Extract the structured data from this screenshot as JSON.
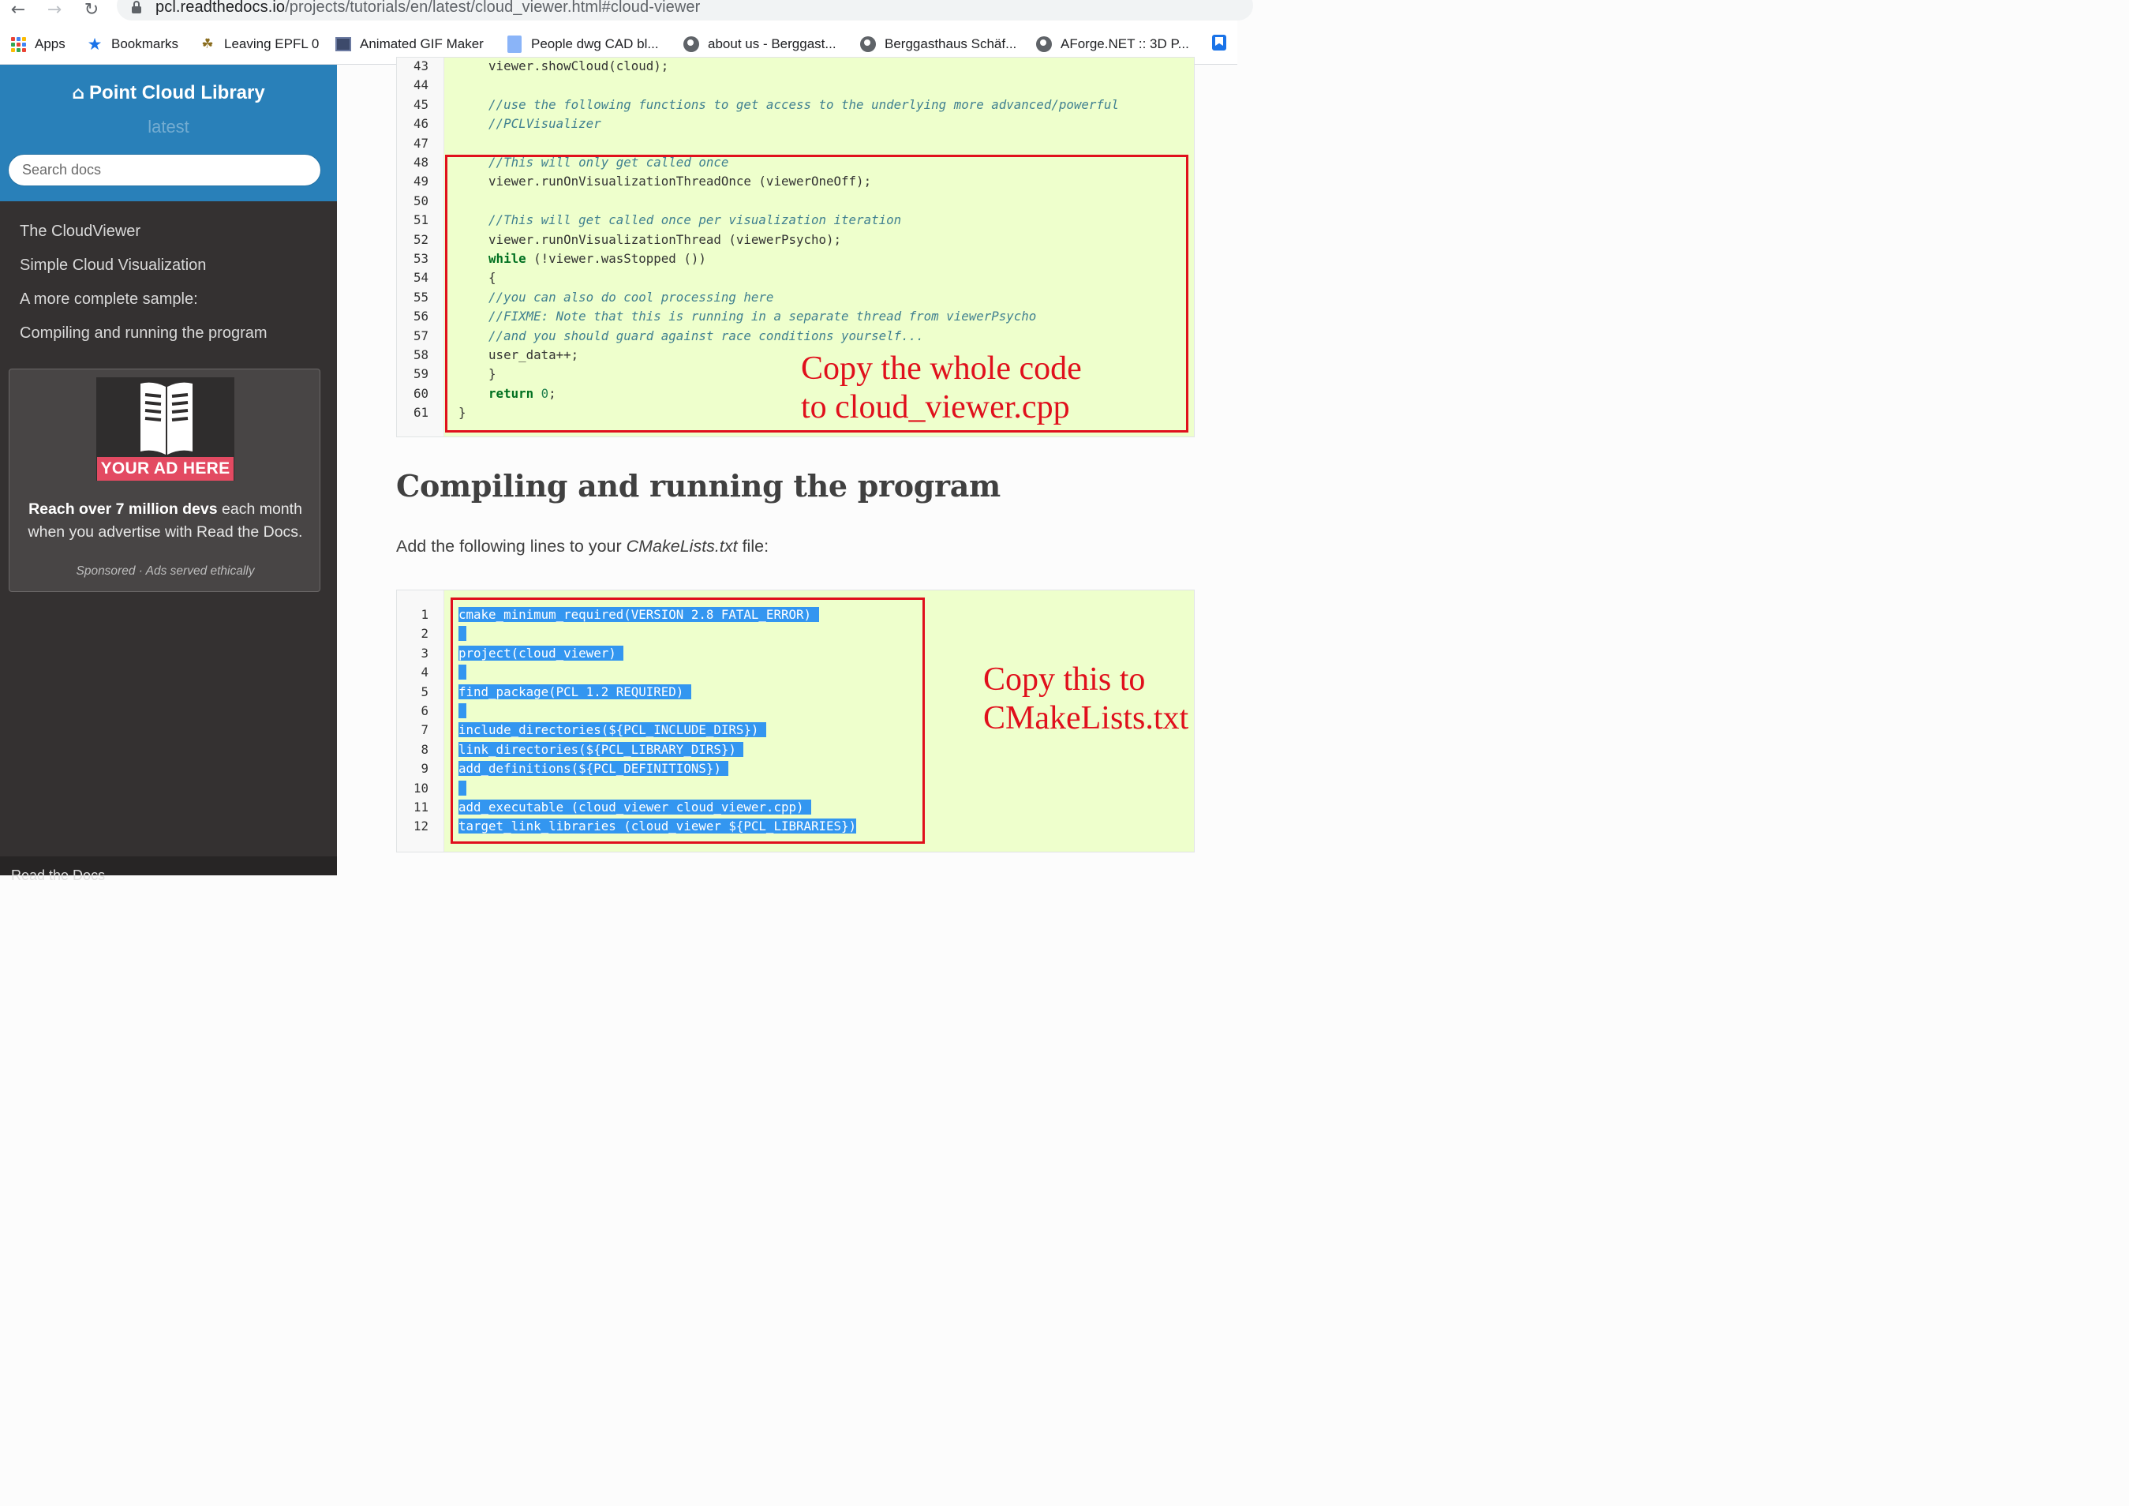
{
  "browser": {
    "url_host": "pcl.readthedocs.io",
    "url_path": "/projects/tutorials/en/latest/cloud_viewer.html#cloud-viewer",
    "bookmarks": [
      {
        "label": "Apps",
        "icon": "apps-grid-icon"
      },
      {
        "label": "Bookmarks",
        "icon": "star-icon"
      },
      {
        "label": "Leaving EPFL 0",
        "icon": "bottles-icon"
      },
      {
        "label": "Animated GIF Maker",
        "icon": "gif-maker-icon"
      },
      {
        "label": "People dwg CAD bl...",
        "icon": "cad-icon"
      },
      {
        "label": "about us - Berggast...",
        "icon": "globe-icon"
      },
      {
        "label": "Berggasthaus Schäf...",
        "icon": "globe-icon"
      },
      {
        "label": "AForge.NET :: 3D P...",
        "icon": "globe-icon"
      }
    ]
  },
  "sidebar": {
    "title": "Point Cloud Library",
    "version": "latest",
    "search_placeholder": "Search docs",
    "toc": [
      "The CloudViewer",
      "Simple Cloud Visualization",
      "A more complete sample:",
      "Compiling and running the program"
    ],
    "ad": {
      "banner": "YOUR AD HERE",
      "text_bold": "Reach over 7 million devs",
      "text_rest1": " each month",
      "text_line2": "when you advertise with Read the Docs.",
      "footer": "Sponsored · Ads served ethically"
    },
    "rtd_label": "Read the Docs"
  },
  "code_block_1": {
    "lines": [
      {
        "n": "43",
        "text": "    viewer.showCloud(cloud);",
        "kind": "plain"
      },
      {
        "n": "44",
        "text": "",
        "kind": "plain"
      },
      {
        "n": "45",
        "text": "    //use the following functions to get access to the underlying more advanced/powerful",
        "kind": "comment"
      },
      {
        "n": "46",
        "text": "    //PCLVisualizer",
        "kind": "comment"
      },
      {
        "n": "47",
        "text": "",
        "kind": "plain"
      },
      {
        "n": "48",
        "text": "    //This will only get called once",
        "kind": "comment"
      },
      {
        "n": "49",
        "text": "    viewer.runOnVisualizationThreadOnce (viewerOneOff);",
        "kind": "plain"
      },
      {
        "n": "50",
        "text": "",
        "kind": "plain"
      },
      {
        "n": "51",
        "text": "    //This will get called once per visualization iteration",
        "kind": "comment"
      },
      {
        "n": "52",
        "text": "    viewer.runOnVisualizationThread (viewerPsycho);",
        "kind": "plain"
      },
      {
        "n": "53",
        "text": "    while (!viewer.wasStopped ())",
        "kind": "while"
      },
      {
        "n": "54",
        "text": "    {",
        "kind": "plain"
      },
      {
        "n": "55",
        "text": "    //you can also do cool processing here",
        "kind": "comment"
      },
      {
        "n": "56",
        "text": "    //FIXME: Note that this is running in a separate thread from viewerPsycho",
        "kind": "comment"
      },
      {
        "n": "57",
        "text": "    //and you should guard against race conditions yourself...",
        "kind": "comment"
      },
      {
        "n": "58",
        "text": "    user_data++;",
        "kind": "plain"
      },
      {
        "n": "59",
        "text": "    }",
        "kind": "plain"
      },
      {
        "n": "60",
        "text": "    return 0;",
        "kind": "return"
      },
      {
        "n": "61",
        "text": "}",
        "kind": "plain"
      }
    ]
  },
  "heading": "Compiling and running the program",
  "intro": {
    "before": "Add the following lines to your ",
    "file": "CMakeLists.txt",
    "after": " file:"
  },
  "code_block_2": {
    "lines": [
      {
        "n": "1",
        "text": "cmake_minimum_required(VERSION 2.8 FATAL_ERROR) "
      },
      {
        "n": "2",
        "text": " "
      },
      {
        "n": "3",
        "text": "project(cloud_viewer) "
      },
      {
        "n": "4",
        "text": " "
      },
      {
        "n": "5",
        "text": "find_package(PCL 1.2 REQUIRED) "
      },
      {
        "n": "6",
        "text": " "
      },
      {
        "n": "7",
        "text": "include_directories(${PCL_INCLUDE_DIRS}) "
      },
      {
        "n": "8",
        "text": "link_directories(${PCL_LIBRARY_DIRS}) "
      },
      {
        "n": "9",
        "text": "add_definitions(${PCL_DEFINITIONS}) "
      },
      {
        "n": "10",
        "text": " "
      },
      {
        "n": "11",
        "text": "add_executable (cloud_viewer cloud_viewer.cpp) "
      },
      {
        "n": "12",
        "text": "target_link_libraries (cloud_viewer ${PCL_LIBRARIES})"
      }
    ]
  },
  "annotations": {
    "first": [
      "Copy the whole code",
      "to cloud_viewer.cpp"
    ],
    "second": [
      "Copy this to",
      "CMakeLists.txt"
    ]
  },
  "colors": {
    "accent": "#2980b9",
    "annotation_red": "#e0101c",
    "selection": "#3396f0",
    "code_bg": "#eeffcc"
  }
}
